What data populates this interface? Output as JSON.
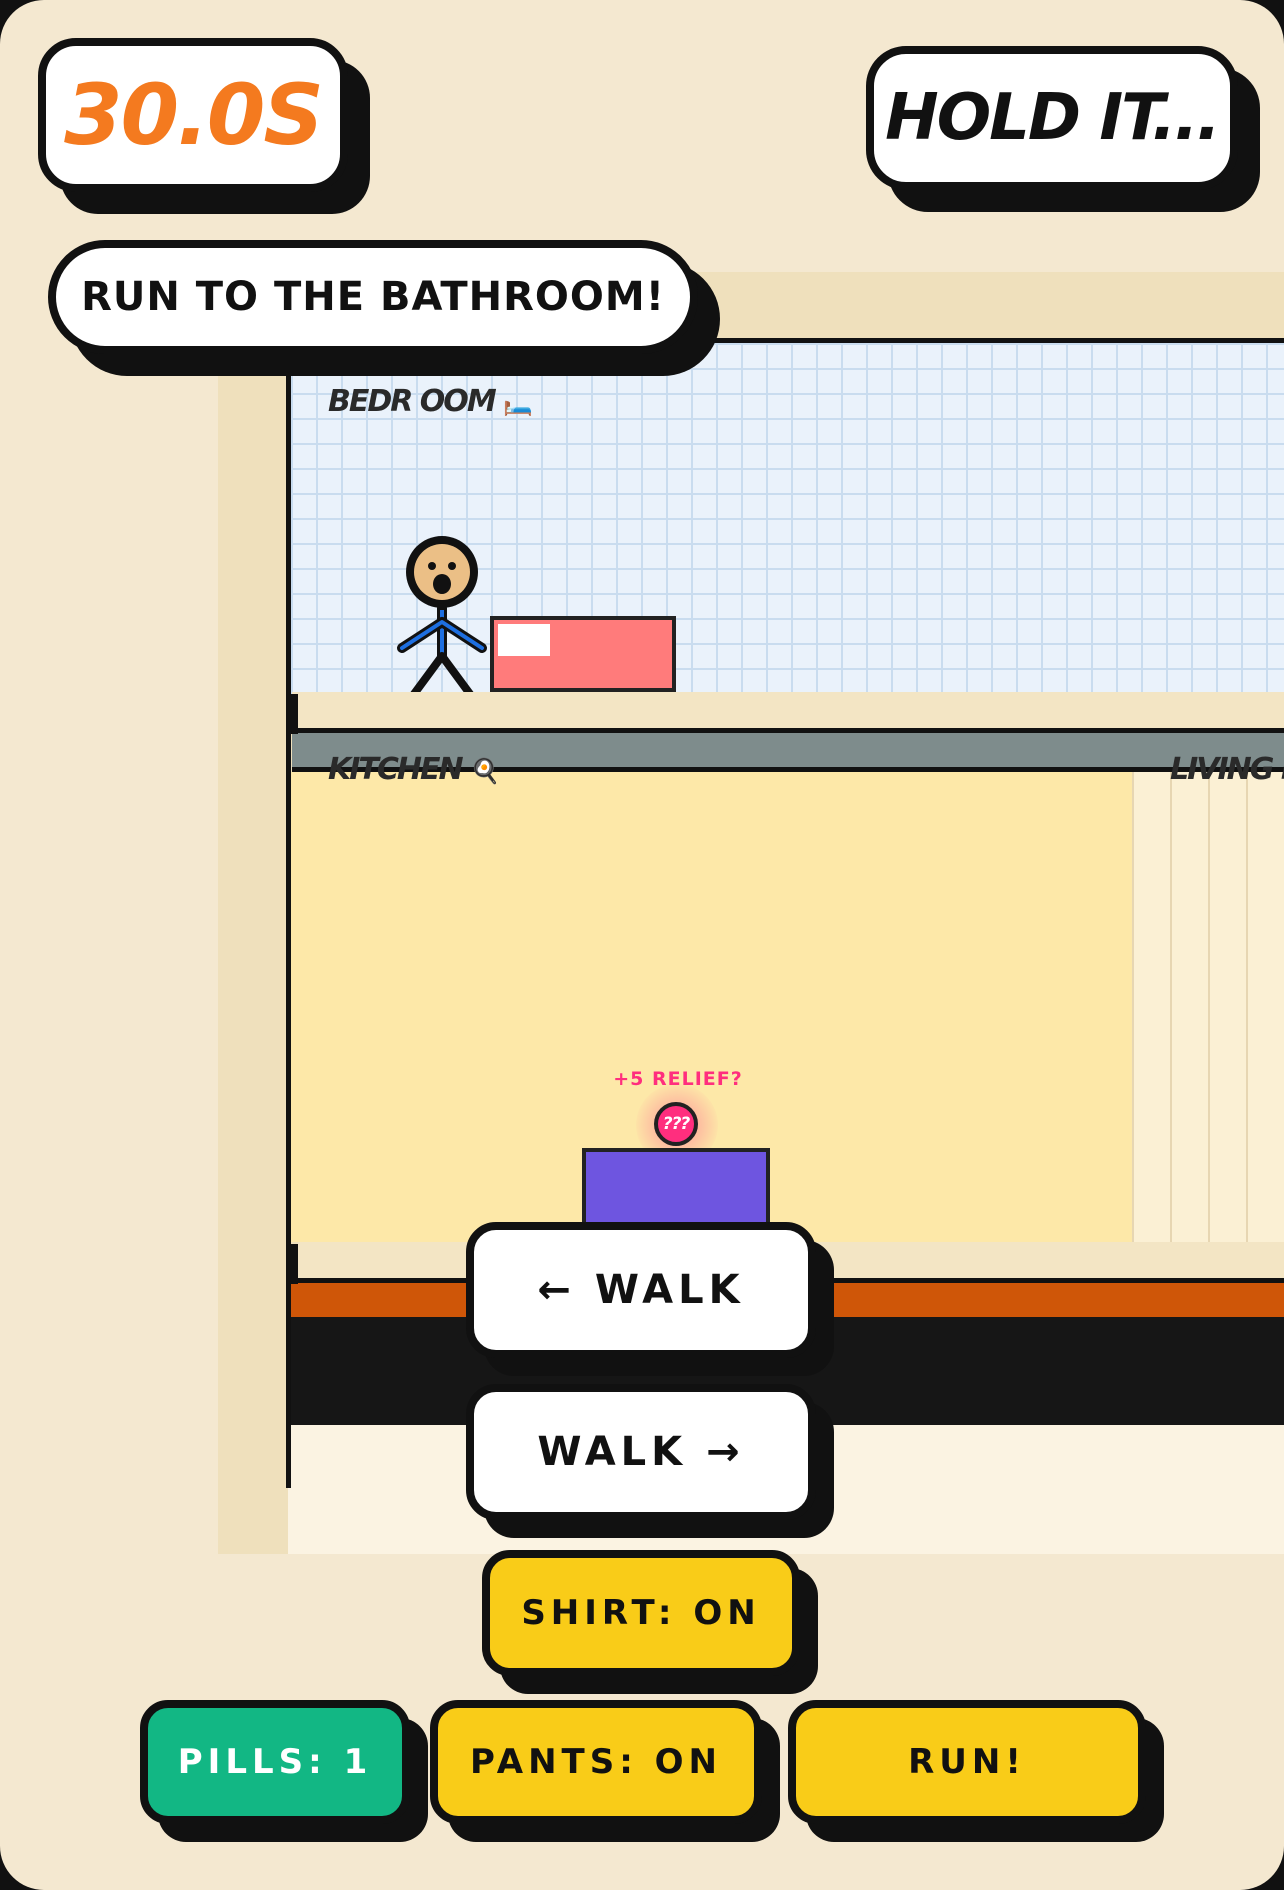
{
  "hud": {
    "timer": "30.0S",
    "status": "HOLD IT...",
    "objective": "RUN TO THE BATHROOM!"
  },
  "rooms": {
    "bedroom": "BEDR OOM",
    "bedroom_emoji": "🛏️",
    "kitchen": "KITCHEN",
    "kitchen_emoji": "🍳",
    "living_room": "LIVING RO"
  },
  "pickup": {
    "hint": "+5 RELIEF?",
    "label": "???"
  },
  "controls": {
    "walk_left": "← WALK",
    "walk_right": "WALK →",
    "shirt": "SHIRT: ON",
    "pills": "PILLS: 1",
    "pants": "PANTS: ON",
    "run": "RUN!"
  },
  "colors": {
    "timer": "#f47a1f",
    "background": "#f4e8d0",
    "bed": "#ff7b7b",
    "table": "#6e55e0",
    "kitchen_wall": "#fde8a8",
    "pill": "#ff2e7e",
    "button_yellow": "#f9cc18",
    "button_green": "#12b784",
    "shirt": "#1e6fe0"
  }
}
